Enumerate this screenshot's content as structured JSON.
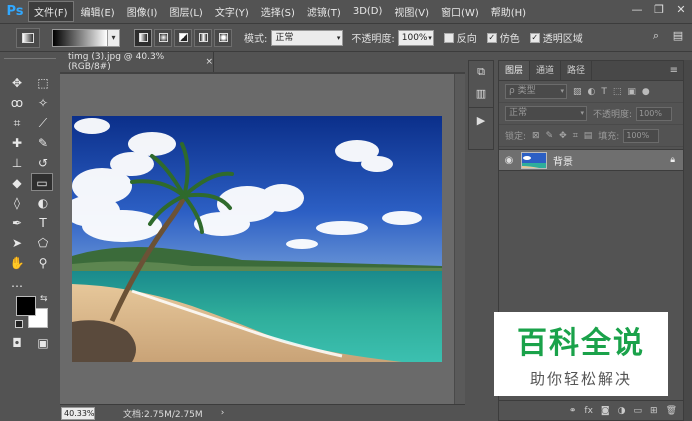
{
  "app": {
    "logo": "Ps"
  },
  "menu": [
    "文件(F)",
    "编辑(E)",
    "图像(I)",
    "图层(L)",
    "文字(Y)",
    "选择(S)",
    "滤镜(T)",
    "3D(D)",
    "视图(V)",
    "窗口(W)",
    "帮助(H)"
  ],
  "window_controls": {
    "minimize": "—",
    "restore": "❐",
    "close": "✕"
  },
  "options": {
    "mode_label": "模式:",
    "mode_value": "正常",
    "opacity_label": "不透明度:",
    "opacity_value": "100%",
    "reverse_label": "反向",
    "dither_label": "仿色",
    "transparency_label": "透明区域"
  },
  "document": {
    "tab_title": "timg (3).jpg @ 40.3%(RGB/8#)",
    "tab_close": "×",
    "zoom": "40.33%",
    "doc_info": "文档:2.75M/2.75M",
    "status_arrow": "›"
  },
  "layers_panel": {
    "tabs": [
      "图层",
      "通道",
      "路径"
    ],
    "filter_placeholder": "ρ 类型",
    "blend_mode": "正常",
    "opacity_label": "不透明度:",
    "opacity_value": "100%",
    "lock_label": "锁定:",
    "fill_label": "填充:",
    "fill_value": "100%",
    "layer_name": "背景"
  },
  "watermark": {
    "title": "百科全说",
    "subtitle": "助你轻松解决"
  },
  "colors": {
    "ui_bg": "#535353",
    "accent_blue": "#31a8ff",
    "watermark_green": "#1aa24a"
  }
}
